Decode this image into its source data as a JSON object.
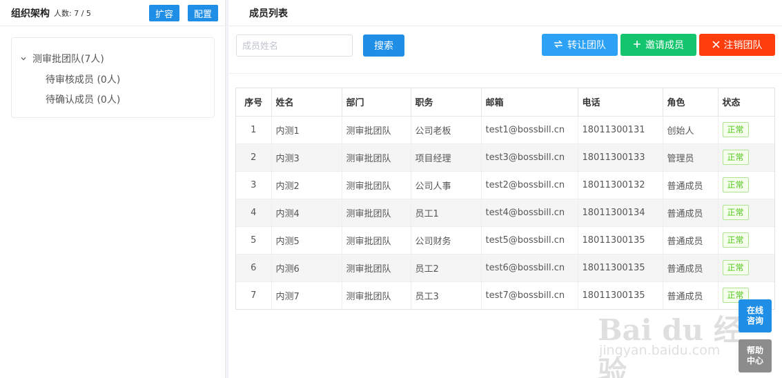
{
  "left_panel": {
    "title": "组织架构",
    "count_text": "人数: 7 / 5",
    "expand_label": "扩容",
    "config_label": "配置",
    "tree": {
      "root_label": "测审批团队(7人)",
      "children": [
        {
          "label": "待审核成员 (0人)"
        },
        {
          "label": "待确认成员 (0人)"
        }
      ]
    }
  },
  "right_panel": {
    "title": "成员列表",
    "search": {
      "placeholder": "成员姓名",
      "value": "",
      "button_label": "搜索"
    },
    "actions": {
      "transfer_label": "转让团队",
      "invite_label": "邀请成员",
      "cancel_label": "注销团队"
    },
    "table": {
      "headers": [
        "序号",
        "姓名",
        "部门",
        "职务",
        "邮箱",
        "电话",
        "角色",
        "状态"
      ],
      "rows": [
        [
          "1",
          "内测1",
          "测审批团队",
          "公司老板",
          "test1@bossbill.cn",
          "18011300131",
          "创始人",
          "正常"
        ],
        [
          "2",
          "内测3",
          "测审批团队",
          "项目经理",
          "test3@bossbill.cn",
          "18011300133",
          "管理员",
          "正常"
        ],
        [
          "3",
          "内测2",
          "测审批团队",
          "公司人事",
          "test2@bossbill.cn",
          "18011300132",
          "普通成员",
          "正常"
        ],
        [
          "4",
          "内测4",
          "测审批团队",
          "员工1",
          "test4@bossbill.cn",
          "18011300134",
          "普通成员",
          "正常"
        ],
        [
          "5",
          "内测5",
          "测审批团队",
          "公司财务",
          "test5@bossbill.cn",
          "18011300135",
          "普通成员",
          "正常"
        ],
        [
          "6",
          "内测6",
          "测审批团队",
          "员工2",
          "test6@bossbill.cn",
          "18011300135",
          "普通成员",
          "正常"
        ],
        [
          "7",
          "内测7",
          "测审批团队",
          "员工3",
          "test7@bossbill.cn",
          "18011300135",
          "普通成员",
          "正常"
        ]
      ]
    }
  },
  "floating": {
    "consult_label": "在线\n咨询",
    "help_label": "帮助\n中心"
  },
  "watermark": {
    "main": "Bai du 经验",
    "sub": "jingyan.baidu.com"
  },
  "colors": {
    "primary_blue": "#1f8ee7",
    "transfer_blue": "#2ca1f5",
    "invite_green": "#14c56e",
    "cancel_red": "#ff3d0d",
    "status_green": "#52c41a",
    "help_gray": "#8c8c8c"
  },
  "icons": {
    "tree_caret": "chevron-down-icon",
    "transfer": "swap-arrows-icon",
    "invite": "plus-icon",
    "cancel": "close-icon"
  }
}
